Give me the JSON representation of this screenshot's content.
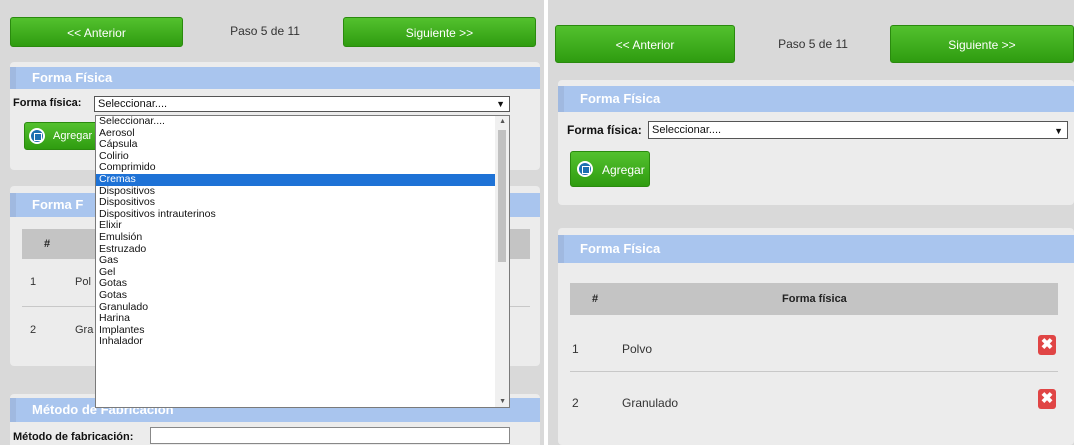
{
  "nav": {
    "prev_label": "<< Anterior",
    "step_label": "Paso 5 de 11",
    "next_label": "Siguiente >>"
  },
  "forma_section": {
    "title": "Forma Física",
    "field_label": "Forma física:",
    "select_value": "Seleccionar....",
    "add_label": "Agregar"
  },
  "dropdown": {
    "options": [
      "Seleccionar....",
      "Aerosol",
      "Cápsula",
      "Colirio",
      "Comprimido",
      "Cremas",
      "Dispositivos",
      "Dispositivos",
      "Dispositivos intrauterinos",
      "Elixir",
      "Emulsión",
      "Estruzado",
      "Gas",
      "Gel",
      "Gotas",
      "Gotas",
      "Granulado",
      "Harina",
      "Implantes",
      "Inhalador"
    ],
    "selected_option": "Cremas"
  },
  "list_section": {
    "title": "Forma Física",
    "title_partial": "Forma F",
    "col_num": "#",
    "col_name": "Forma física",
    "rows": [
      {
        "num": "1",
        "name": "Polvo",
        "name_partial": "Pol"
      },
      {
        "num": "2",
        "name": "Granulado",
        "name_partial": "Gra"
      }
    ]
  },
  "metodo_section": {
    "title": "Método de Fabricación",
    "field_label": "Método de fabricación:"
  },
  "colors": {
    "green": "#3aa81a",
    "title_blue": "#a9c5ee",
    "delete_red": "#e04545",
    "selected_blue": "#1e72d6"
  }
}
